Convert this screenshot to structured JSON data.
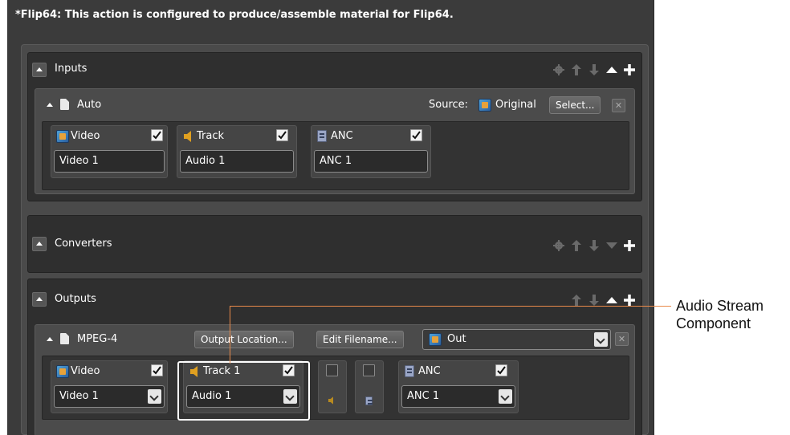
{
  "header": {
    "title": "*Flip64: This action is configured to produce/assemble material for Flip64."
  },
  "inputs": {
    "title": "Inputs",
    "item": {
      "title": "Auto",
      "source_label": "Source:",
      "source_value": "Original",
      "select_button": "Select...",
      "components": [
        {
          "label": "Video",
          "value": "Video 1",
          "checked": true
        },
        {
          "label": "Track",
          "value": "Audio 1",
          "checked": true
        },
        {
          "label": "ANC",
          "value": "ANC 1",
          "checked": true
        }
      ]
    }
  },
  "converters": {
    "title": "Converters"
  },
  "outputs": {
    "title": "Outputs",
    "item": {
      "title": "MPEG-4",
      "output_location_button": "Output Location...",
      "edit_filename_button": "Edit Filename...",
      "out_select": "Out",
      "components": [
        {
          "label": "Video",
          "value": "Video 1",
          "checked": true
        },
        {
          "label": "Track 1",
          "value": "Audio 1",
          "checked": true
        },
        {
          "label": "ANC",
          "value": "ANC 1",
          "checked": true
        }
      ]
    }
  },
  "callout": {
    "line1": "Audio Stream",
    "line2": "Component",
    "color": "#e88a4a"
  },
  "icons": [
    "gear-icon",
    "arrow-up-icon",
    "arrow-down-icon",
    "triangle-up-icon",
    "triangle-down-icon",
    "plus-icon",
    "close-icon"
  ]
}
